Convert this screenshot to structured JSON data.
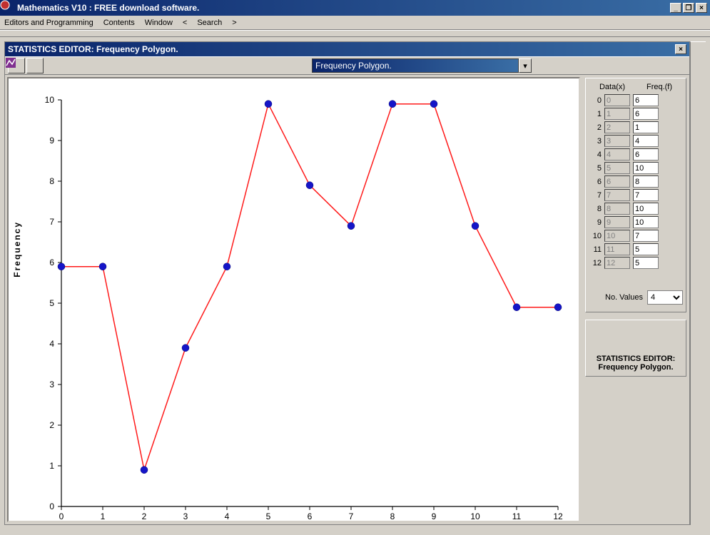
{
  "app": {
    "title": "Mathematics V10 : FREE download software."
  },
  "menu": {
    "items": [
      "Editors and Programming",
      "Contents",
      "Window",
      "<",
      "Search",
      ">"
    ]
  },
  "editor": {
    "title": "STATISTICS EDITOR:   Frequency Polygon.",
    "combo_label": "Frequency Polygon."
  },
  "sidebar": {
    "data_header": "Data(x)",
    "freq_header": "Freq.(f)",
    "rows": [
      {
        "idx": "0",
        "x": "0",
        "f": "6"
      },
      {
        "idx": "1",
        "x": "1",
        "f": "6"
      },
      {
        "idx": "2",
        "x": "2",
        "f": "1"
      },
      {
        "idx": "3",
        "x": "3",
        "f": "4"
      },
      {
        "idx": "4",
        "x": "4",
        "f": "6"
      },
      {
        "idx": "5",
        "x": "5",
        "f": "10"
      },
      {
        "idx": "6",
        "x": "6",
        "f": "8"
      },
      {
        "idx": "7",
        "x": "7",
        "f": "7"
      },
      {
        "idx": "8",
        "x": "8",
        "f": "10"
      },
      {
        "idx": "9",
        "x": "9",
        "f": "10"
      },
      {
        "idx": "10",
        "x": "10",
        "f": "7"
      },
      {
        "idx": "11",
        "x": "11",
        "f": "5"
      },
      {
        "idx": "12",
        "x": "12",
        "f": "5"
      }
    ],
    "no_values_label": "No. Values",
    "no_values_value": "4"
  },
  "status": {
    "line1": "STATISTICS EDITOR:",
    "line2": "Frequency Polygon."
  },
  "chart_data": {
    "type": "line",
    "x": [
      0,
      1,
      2,
      3,
      4,
      5,
      6,
      7,
      8,
      9,
      10,
      11,
      12
    ],
    "y": [
      5.9,
      5.9,
      0.9,
      3.9,
      5.9,
      9.9,
      7.9,
      6.9,
      9.9,
      9.9,
      6.9,
      4.9,
      4.9
    ],
    "ylabel": "Frequency",
    "xlabel": "",
    "xlim": [
      0,
      12
    ],
    "ylim": [
      0,
      10
    ],
    "xticks": [
      0,
      1,
      2,
      3,
      4,
      5,
      6,
      7,
      8,
      9,
      10,
      11,
      12
    ],
    "yticks": [
      0,
      1,
      2,
      3,
      4,
      5,
      6,
      7,
      8,
      9,
      10
    ],
    "marker_color": "#1515c8",
    "line_color": "#ff1a1a"
  }
}
